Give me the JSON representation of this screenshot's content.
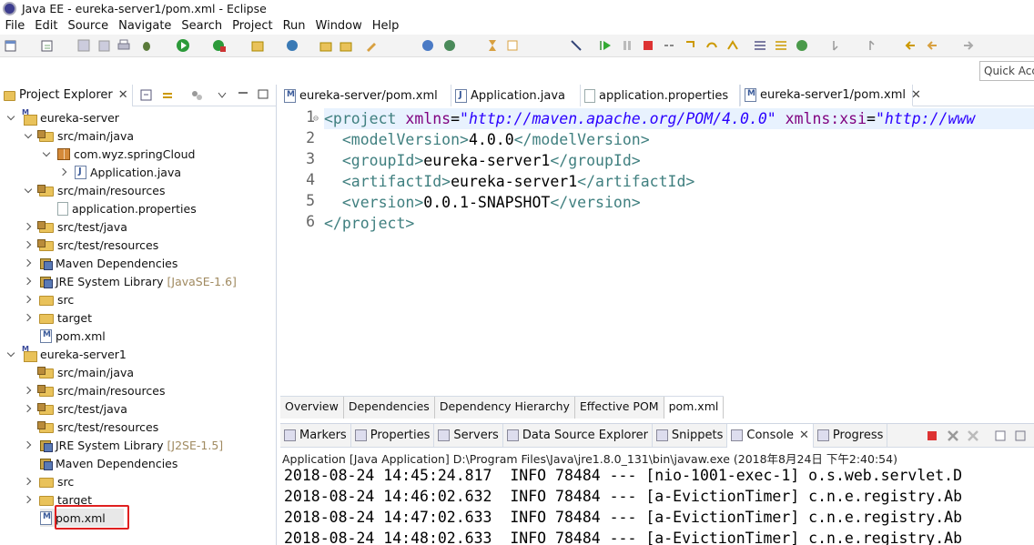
{
  "window": {
    "title": "Java EE - eureka-server1/pom.xml - Eclipse"
  },
  "menu": [
    "File",
    "Edit",
    "Source",
    "Navigate",
    "Search",
    "Project",
    "Run",
    "Window",
    "Help"
  ],
  "quick_access": {
    "placeholder": "Quick Access"
  },
  "project_explorer": {
    "title": "Project Explorer",
    "items": [
      {
        "label": "eureka-server",
        "icon": "maven-project-icon",
        "expanded": true
      },
      {
        "label": "src/main/java",
        "icon": "source-folder-icon",
        "expanded": true
      },
      {
        "label": "com.wyz.springCloud",
        "icon": "package-icon",
        "expanded": true
      },
      {
        "label": "Application.java",
        "icon": "java-file-icon",
        "expanded": false
      },
      {
        "label": "src/main/resources",
        "icon": "source-folder-icon",
        "expanded": true
      },
      {
        "label": "application.properties",
        "icon": "properties-file-icon"
      },
      {
        "label": "src/test/java",
        "icon": "source-folder-icon",
        "expanded": false
      },
      {
        "label": "src/test/resources",
        "icon": "source-folder-icon",
        "expanded": false
      },
      {
        "label": "Maven Dependencies",
        "icon": "library-icon",
        "expanded": false
      },
      {
        "label": "JRE System Library",
        "decoration": "[JavaSE-1.6]",
        "icon": "library-icon",
        "expanded": false
      },
      {
        "label": "src",
        "icon": "folder-icon",
        "expanded": false
      },
      {
        "label": "target",
        "icon": "folder-icon",
        "expanded": false
      },
      {
        "label": "pom.xml",
        "icon": "xml-file-icon"
      },
      {
        "label": "eureka-server1",
        "icon": "maven-project-icon",
        "expanded": true
      },
      {
        "label": "src/main/java",
        "icon": "source-folder-icon",
        "expanded": false
      },
      {
        "label": "src/main/resources",
        "icon": "source-folder-icon",
        "expanded": false
      },
      {
        "label": "src/test/java",
        "icon": "source-folder-icon",
        "expanded": false
      },
      {
        "label": "src/test/resources",
        "icon": "source-folder-icon",
        "expanded": false
      },
      {
        "label": "JRE System Library",
        "decoration": "[J2SE-1.5]",
        "icon": "library-icon",
        "expanded": false
      },
      {
        "label": "Maven Dependencies",
        "icon": "library-icon",
        "expanded": false
      },
      {
        "label": "src",
        "icon": "folder-icon",
        "expanded": false
      },
      {
        "label": "target",
        "icon": "folder-icon",
        "expanded": false
      },
      {
        "label": "pom.xml",
        "icon": "xml-file-icon",
        "selected": true
      }
    ]
  },
  "editor": {
    "tabs": [
      "eureka-server/pom.xml",
      "Application.java",
      "application.properties",
      "eureka-server1/pom.xml"
    ],
    "active_tab": "eureka-server1/pom.xml",
    "line_numbers": [
      "1",
      "2",
      "3",
      "4",
      "5",
      "6"
    ],
    "lines": [
      {
        "parts": [
          [
            "tag",
            "<project "
          ],
          [
            "attr",
            "xmlns"
          ],
          [
            "txt",
            "="
          ],
          [
            "val",
            "\"http://maven.apache.org/POM/4.0.0\""
          ],
          [
            "txt",
            " "
          ],
          [
            "attr",
            "xmlns:xsi"
          ],
          [
            "txt",
            "="
          ],
          [
            "val",
            "\"http://www"
          ]
        ]
      },
      {
        "parts": [
          [
            "txt",
            "  "
          ],
          [
            "tag",
            "<modelVersion>"
          ],
          [
            "txt",
            "4.0.0"
          ],
          [
            "tag",
            "</modelVersion>"
          ]
        ]
      },
      {
        "parts": [
          [
            "txt",
            "  "
          ],
          [
            "tag",
            "<groupId>"
          ],
          [
            "txt",
            "eureka-server1"
          ],
          [
            "tag",
            "</groupId>"
          ]
        ]
      },
      {
        "parts": [
          [
            "txt",
            "  "
          ],
          [
            "tag",
            "<artifactId>"
          ],
          [
            "txt",
            "eureka-server1"
          ],
          [
            "tag",
            "</artifactId>"
          ]
        ]
      },
      {
        "parts": [
          [
            "txt",
            "  "
          ],
          [
            "tag",
            "<version>"
          ],
          [
            "txt",
            "0.0.1-SNAPSHOT"
          ],
          [
            "tag",
            "</version>"
          ]
        ]
      },
      {
        "parts": [
          [
            "tag",
            "</project>"
          ]
        ]
      }
    ],
    "pom_tabs": [
      "Overview",
      "Dependencies",
      "Dependency Hierarchy",
      "Effective POM",
      "pom.xml"
    ],
    "pom_active": "pom.xml"
  },
  "console": {
    "tabs": [
      "Markers",
      "Properties",
      "Servers",
      "Data Source Explorer",
      "Snippets",
      "Console",
      "Progress"
    ],
    "active_tab": "Console",
    "description": "Application [Java Application] D:\\Program Files\\Java\\jre1.8.0_131\\bin\\javaw.exe (2018年8月24日 下午2:40:54)",
    "lines": [
      "2018-08-24 14:45:24.817  INFO 78484 --- [nio-1001-exec-1] o.s.web.servlet.D",
      "2018-08-24 14:46:02.632  INFO 78484 --- [a-EvictionTimer] c.n.e.registry.Ab",
      "2018-08-24 14:47:02.633  INFO 78484 --- [a-EvictionTimer] c.n.e.registry.Ab",
      "2018-08-24 14:48:02.633  INFO 78484 --- [a-EvictionTimer] c.n.e.registry.Ab"
    ]
  },
  "colors": {
    "xml_tag": "#3f7f7f",
    "xml_attr": "#7f007f",
    "xml_value": "#2a00ff",
    "highlight_box": "#e02020",
    "current_line": "#e8f2fe"
  }
}
